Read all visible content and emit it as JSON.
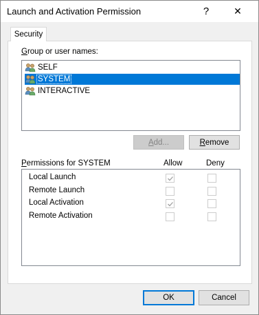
{
  "window": {
    "title": "Launch and Activation Permission",
    "help_glyph": "?",
    "close_glyph": "✕"
  },
  "tab": {
    "label": "Security"
  },
  "group": {
    "label_first": "G",
    "label_rest": "roup or user names:",
    "users": [
      {
        "name": "SELF",
        "icon": "user-group-icon",
        "selected": false
      },
      {
        "name": "SYSTEM",
        "icon": "user-group-icon",
        "selected": true
      },
      {
        "name": "INTERACTIVE",
        "icon": "user-group-icon",
        "selected": false
      }
    ],
    "add_label_first": "A",
    "add_label_rest": "dd...",
    "remove_label_first": "R",
    "remove_label_rest": "emove"
  },
  "permissions": {
    "label_first": "P",
    "label_rest": "ermissions for SYSTEM",
    "allow_header": "Allow",
    "deny_header": "Deny",
    "rows": [
      {
        "name": "Local Launch",
        "allow": true,
        "deny": false
      },
      {
        "name": "Remote Launch",
        "allow": false,
        "deny": false
      },
      {
        "name": "Local Activation",
        "allow": true,
        "deny": false
      },
      {
        "name": "Remote Activation",
        "allow": false,
        "deny": false
      }
    ]
  },
  "footer": {
    "ok_label": "OK",
    "cancel_label": "Cancel"
  },
  "colors": {
    "selection": "#0078d7",
    "check_disabled": "#a0a0a0"
  }
}
